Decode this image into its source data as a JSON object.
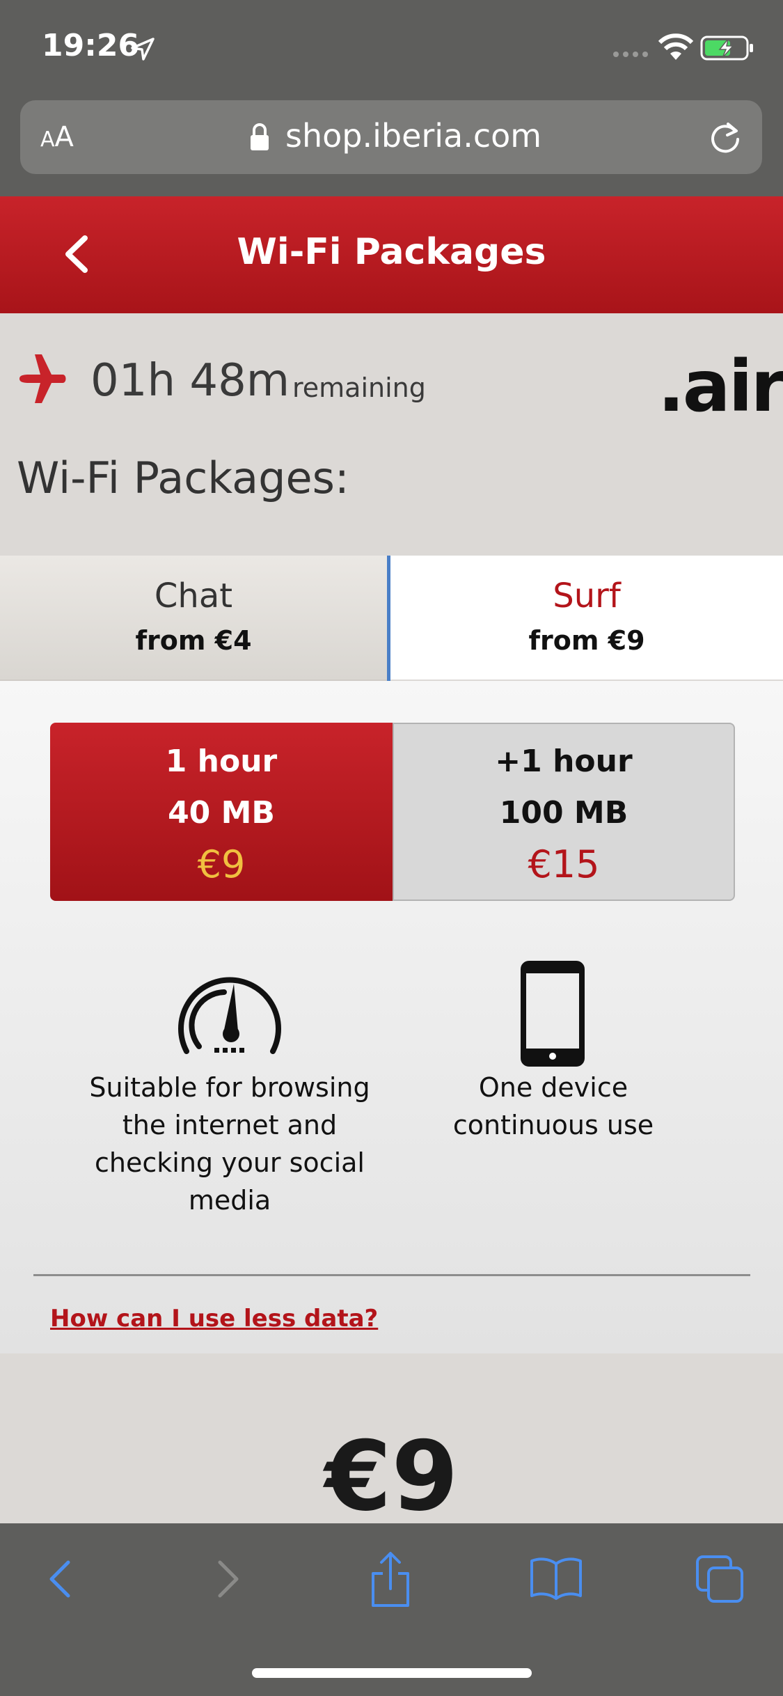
{
  "status_bar": {
    "time": "19:26"
  },
  "browser": {
    "text_size_small": "A",
    "text_size_large": "A",
    "url": "shop.iberia.com"
  },
  "header": {
    "title": "Wi-Fi Packages"
  },
  "flight": {
    "time_remaining": "01h 48m",
    "remaining_label": "remaining",
    "provider_logo": ".air"
  },
  "section_title": "Wi-Fi Packages:",
  "tabs": [
    {
      "name": "Chat",
      "price": "from €4",
      "selected": false
    },
    {
      "name": "Surf",
      "price": "from €9",
      "selected": true
    }
  ],
  "options": [
    {
      "duration": "1 hour",
      "data": "40 MB",
      "price": "€9",
      "selected": true
    },
    {
      "duration": "+1 hour",
      "data": "100 MB",
      "price": "€15",
      "selected": false
    }
  ],
  "features": [
    {
      "icon": "speedometer-icon",
      "text": "Suitable for browsing the internet and checking your social media"
    },
    {
      "icon": "smartphone-icon",
      "text": "One device continuous use"
    }
  ],
  "less_data_link": "How can I use less data?",
  "total_price": "€9",
  "colors": {
    "brand_red": "#c8232a",
    "link_red": "#b3141a",
    "selected_price": "#f0c040",
    "tab_accent": "#4a7fc7",
    "safari_blue": "#4a8ef0"
  }
}
